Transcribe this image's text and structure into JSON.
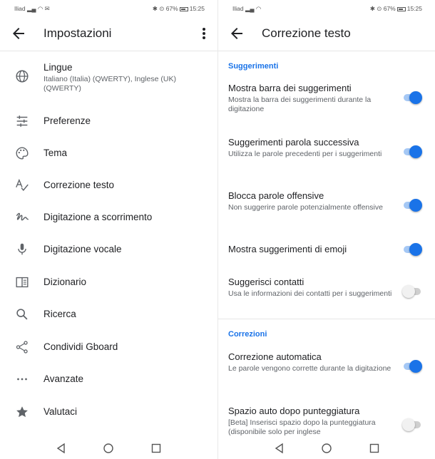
{
  "left": {
    "status": {
      "carrier": "Iliad",
      "battery": "67%",
      "time": "15:25"
    },
    "title": "Impostazioni",
    "items": [
      {
        "label": "Lingue",
        "sub": "Italiano (Italia) (QWERTY), Inglese (UK) (QWERTY)",
        "icon": "globe-icon"
      },
      {
        "label": "Preferenze",
        "icon": "sliders-icon"
      },
      {
        "label": "Tema",
        "icon": "palette-icon"
      },
      {
        "label": "Correzione testo",
        "icon": "spellcheck-icon"
      },
      {
        "label": "Digitazione a scorrimento",
        "icon": "gesture-icon"
      },
      {
        "label": "Digitazione vocale",
        "icon": "microphone-icon"
      },
      {
        "label": "Dizionario",
        "icon": "book-icon"
      },
      {
        "label": "Ricerca",
        "icon": "search-icon"
      },
      {
        "label": "Condividi Gboard",
        "icon": "share-icon"
      },
      {
        "label": "Avanzate",
        "icon": "more-horiz-icon"
      },
      {
        "label": "Valutaci",
        "icon": "star-icon"
      }
    ]
  },
  "right": {
    "status": {
      "carrier": "Iliad",
      "battery": "67%",
      "time": "15:25"
    },
    "title": "Correzione testo",
    "section1": "Suggerimenti",
    "section2": "Correzioni",
    "settings": [
      {
        "title": "Mostra barra dei suggerimenti",
        "sub": "Mostra la barra dei suggerimenti durante la digitazione",
        "on": true
      },
      {
        "title": "Suggerimenti parola successiva",
        "sub": "Utilizza le parole precedenti per i suggerimenti",
        "on": true
      },
      {
        "title": "Blocca parole offensive",
        "sub": "Non suggerire parole potenzialmente offensive",
        "on": true
      },
      {
        "title": "Mostra suggerimenti di emoji",
        "sub": "",
        "on": true
      },
      {
        "title": "Suggerisci contatti",
        "sub": "Usa le informazioni dei contatti per i suggerimenti",
        "on": false
      },
      {
        "title": "Correzione automatica",
        "sub": "Le parole vengono corrette durante la digitazione",
        "on": true
      },
      {
        "title": "Spazio auto dopo punteggiatura",
        "sub": "[Beta] Inserisci spazio dopo la punteggiatura (disponibile solo per inglese",
        "on": false
      }
    ]
  },
  "colors": {
    "accent": "#1a73e8",
    "toggle_track_on": "#a5c8f5",
    "toggle_off": "#cfcfcf"
  }
}
